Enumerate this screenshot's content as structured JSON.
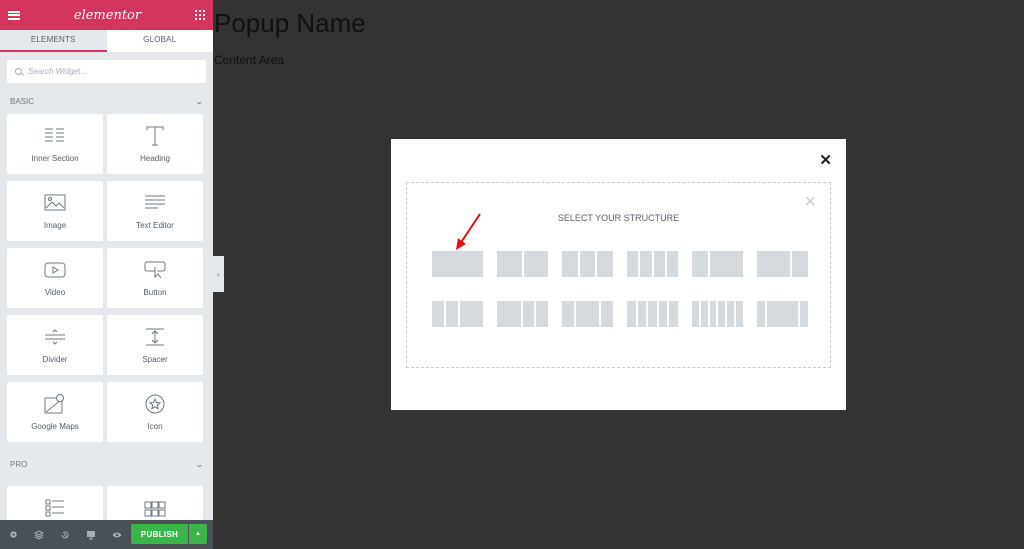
{
  "panel": {
    "logo": "elementor",
    "tabs": [
      "ELEMENTS",
      "GLOBAL"
    ],
    "search_placeholder": "Search Widget...",
    "sections": {
      "basic": "BASIC",
      "pro": "PRO"
    },
    "widgets": [
      {
        "label": "Inner Section",
        "icon": "inner-section-icon"
      },
      {
        "label": "Heading",
        "icon": "heading-icon"
      },
      {
        "label": "Image",
        "icon": "image-icon"
      },
      {
        "label": "Text Editor",
        "icon": "text-editor-icon"
      },
      {
        "label": "Video",
        "icon": "video-icon"
      },
      {
        "label": "Button",
        "icon": "button-icon"
      },
      {
        "label": "Divider",
        "icon": "divider-icon"
      },
      {
        "label": "Spacer",
        "icon": "spacer-icon"
      },
      {
        "label": "Google Maps",
        "icon": "google-maps-icon"
      },
      {
        "label": "Icon",
        "icon": "star-icon"
      }
    ],
    "footer": {
      "publish": "PUBLISH"
    }
  },
  "page": {
    "title": "Popup Name",
    "content": "Content Area"
  },
  "modal": {
    "title": "SELECT YOUR STRUCTURE",
    "structures": [
      [
        100
      ],
      [
        50,
        50
      ],
      [
        33,
        33,
        33
      ],
      [
        25,
        25,
        25,
        25
      ],
      [
        33,
        66
      ],
      [
        66,
        33
      ],
      [
        25,
        25,
        50
      ],
      [
        50,
        25,
        25
      ],
      [
        25,
        50,
        25
      ],
      [
        20,
        20,
        20,
        20,
        20
      ],
      [
        16,
        16,
        16,
        16,
        16,
        16
      ],
      [
        16,
        66,
        16
      ]
    ]
  },
  "colors": {
    "brand": "#d5345c",
    "publish": "#39b54a"
  }
}
